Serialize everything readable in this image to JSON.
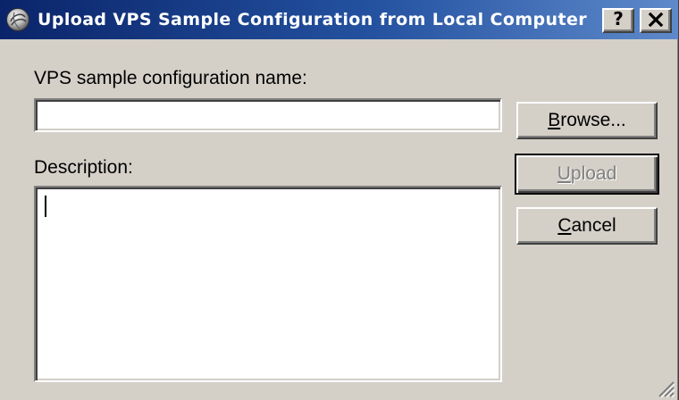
{
  "window": {
    "title": "Upload VPS Sample Configuration from Local Computer",
    "app_icon": "app-icon",
    "help_icon": "help-icon",
    "close_icon": "close-icon"
  },
  "form": {
    "name_field": {
      "label": "VPS sample configuration name:",
      "value": ""
    },
    "description_field": {
      "label": "Description:",
      "value": ""
    }
  },
  "buttons": {
    "browse": {
      "label": "Browse...",
      "accel": "B",
      "enabled": true
    },
    "upload": {
      "label": "Upload",
      "accel": "U",
      "enabled": false,
      "default": true
    },
    "cancel": {
      "label": "Cancel",
      "accel": "C",
      "enabled": true
    }
  },
  "colors": {
    "title_bar_start": "#0A246A",
    "title_bar_end": "#5E8ACB",
    "face": "#D4D0C8"
  }
}
